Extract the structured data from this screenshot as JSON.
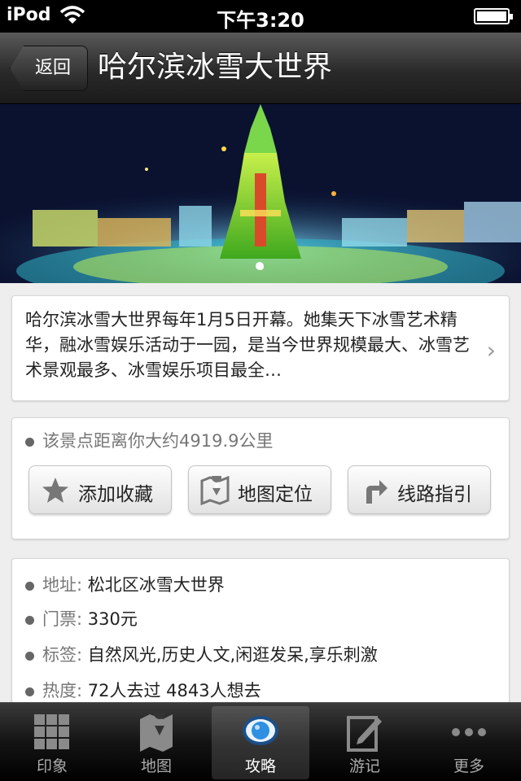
{
  "status_bar": {
    "carrier": "iPod",
    "time": "下午3:20"
  },
  "nav": {
    "back_label": "返回",
    "title": "哈尔滨冰雪大世界"
  },
  "hero": {
    "page_count": 1,
    "current_page": 1
  },
  "description": {
    "text": "哈尔滨冰雪大世界每年1月5日开幕。她集天下冰雪艺术精华，融冰雪娱乐活动于一园，是当今世界规模最大、冰雪艺术景观最多、冰雪娱乐项目最全…"
  },
  "distance": {
    "text": "该景点距离你大约4919.9公里"
  },
  "actions": {
    "favorite_label": "添加收藏",
    "map_label": "地图定位",
    "route_label": "线路指引"
  },
  "info": {
    "address_key": "地址:",
    "address_value": "松北区冰雪大世界",
    "ticket_key": "门票:",
    "ticket_value": "330元",
    "tags_key": "标签:",
    "tags_value": "自然风光,历史人文,闲逛发呆,享乐刺激",
    "heat_key": "热度:",
    "heat_value": "72人去过  4843人想去"
  },
  "tabs": [
    {
      "label": "印象",
      "icon": "grid-icon"
    },
    {
      "label": "地图",
      "icon": "map-icon"
    },
    {
      "label": "攻略",
      "icon": "eye-icon",
      "active": true
    },
    {
      "label": "游记",
      "icon": "notepad-icon"
    },
    {
      "label": "更多",
      "icon": "more-dots-icon"
    }
  ],
  "colors": {
    "nav_bg": "#2a2a2a",
    "tab_active_ring": "#2f8fe0"
  }
}
